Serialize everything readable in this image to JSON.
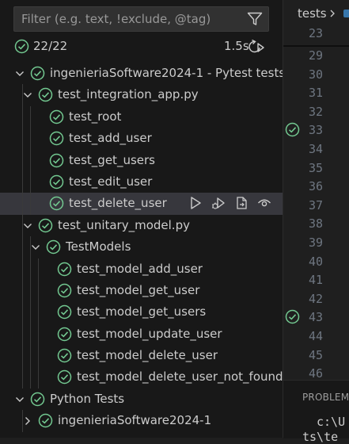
{
  "filter": {
    "placeholder": "Filter (e.g. text, !exclude, @tag)",
    "icon": "filter-icon"
  },
  "summary": {
    "passed": "22/22",
    "duration": "1.5s"
  },
  "tree": [
    {
      "label": "ingenieriaSoftware2024-1 - Pytest tests",
      "depth": 0,
      "chevron": "down",
      "status": "passed"
    },
    {
      "label": "test_integration_app.py",
      "depth": 1,
      "chevron": "down",
      "status": "passed"
    },
    {
      "label": "test_root",
      "depth": 2,
      "status": "passed"
    },
    {
      "label": "test_add_user",
      "depth": 2,
      "status": "passed"
    },
    {
      "label": "test_get_users",
      "depth": 2,
      "status": "passed"
    },
    {
      "label": "test_edit_user",
      "depth": 2,
      "status": "passed"
    },
    {
      "label": "test_delete_user",
      "depth": 2,
      "status": "passed",
      "selected": true
    },
    {
      "label": "test_unitary_model.py",
      "depth": 1,
      "chevron": "down",
      "status": "passed"
    },
    {
      "label": "TestModels",
      "depth": 2,
      "chevron": "down",
      "status": "passed"
    },
    {
      "label": "test_model_add_user",
      "depth": 3,
      "status": "passed"
    },
    {
      "label": "test_model_get_user",
      "depth": 3,
      "status": "passed"
    },
    {
      "label": "test_model_get_users",
      "depth": 3,
      "status": "passed"
    },
    {
      "label": "test_model_update_user",
      "depth": 3,
      "status": "passed"
    },
    {
      "label": "test_model_delete_user",
      "depth": 3,
      "status": "passed"
    },
    {
      "label": "test_model_delete_user_not_found",
      "depth": 3,
      "status": "passed"
    },
    {
      "label": "Python Tests",
      "depth": 0,
      "chevron": "down",
      "status": "passed"
    },
    {
      "label": "ingenieriaSoftware2024-1",
      "depth": 1,
      "chevron": "right",
      "status": "passed"
    }
  ],
  "row_actions": [
    "run-test-icon",
    "debug-test-icon",
    "go-to-test-icon",
    "watch-test-icon"
  ],
  "editor": {
    "breadcrumb": "tests",
    "sticky_line": "23",
    "line_numbers": [
      "29",
      "30",
      "31",
      "32",
      "33",
      "34",
      "35",
      "36",
      "37",
      "38",
      "39",
      "40",
      "41",
      "42",
      "43",
      "44",
      "45",
      "46"
    ],
    "passed_gutter_lines": [
      "33",
      "43"
    ]
  },
  "panel": {
    "title": "PROBLEM",
    "line1": "c:\\U",
    "line2": "ts\\te"
  },
  "colors": {
    "pass": "#73c991",
    "selection": "#37373d",
    "background": "#181818"
  }
}
